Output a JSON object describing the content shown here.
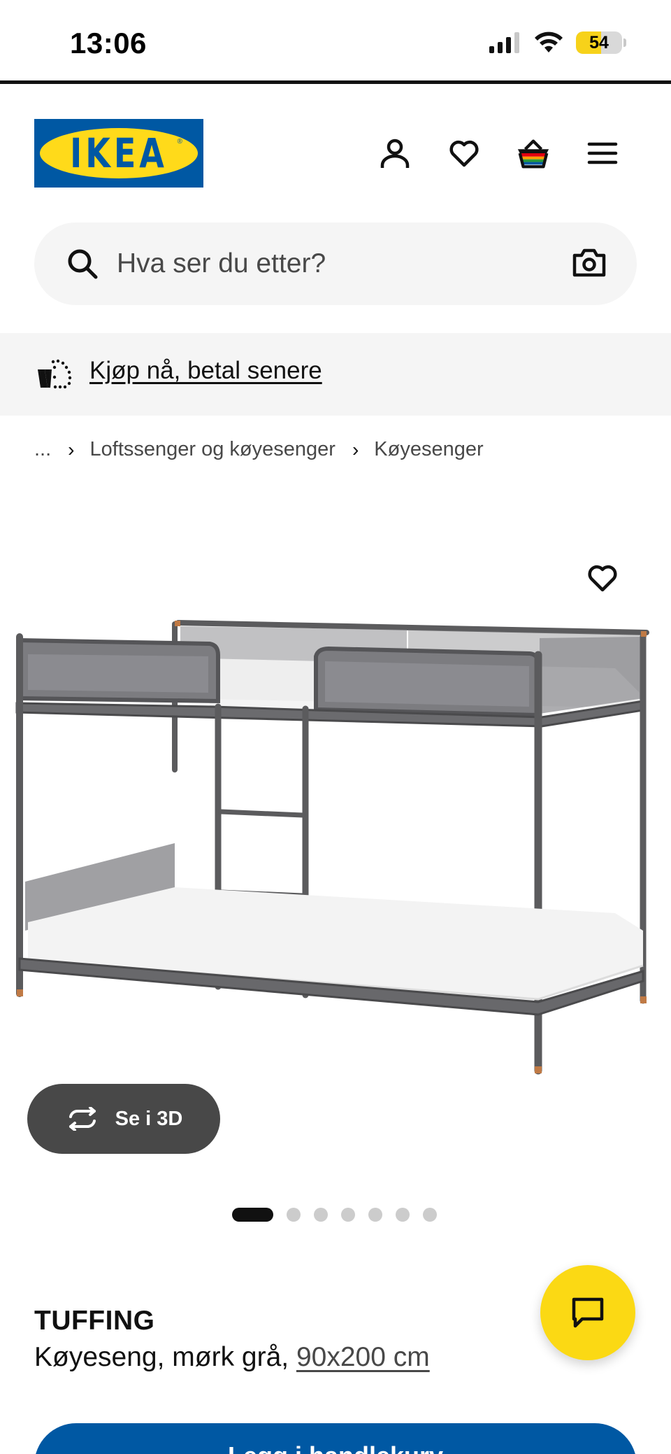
{
  "status_bar": {
    "time": "13:06",
    "battery_level": "54",
    "battery_fraction": 0.54,
    "icons": [
      "cellular-signal-icon",
      "wifi-icon",
      "battery-icon"
    ]
  },
  "header": {
    "logo_text": "IKEA",
    "logo_registered": "®",
    "colors": {
      "brand_blue": "#0058a3",
      "brand_yellow": "#ffda1a"
    },
    "icons": [
      "account-icon",
      "heart-icon",
      "shopping-basket-icon",
      "menu-icon"
    ]
  },
  "search": {
    "placeholder": "Hva ser du etter?",
    "icons": [
      "search-icon",
      "camera-icon"
    ]
  },
  "banner": {
    "link_text": "Kjøp nå, betal senere",
    "icon": "pay-later-bag-icon"
  },
  "breadcrumb": {
    "items": [
      "...",
      "Loftssenger og køyesenger",
      "Køyesenger"
    ]
  },
  "product": {
    "image_icon": "bunk-bed-image",
    "view_3d_label": "Se i 3D",
    "carousel": {
      "count": 7,
      "active_index": 0
    },
    "name": "TUFFING",
    "description": "Køyeseng, mørk grå, ",
    "size": "90x200 cm"
  },
  "chat": {
    "icon": "chat-bubble-icon",
    "color": "#fbd914"
  },
  "cart_button": {
    "label": "Legg i handlekurv",
    "color": "#0058a3"
  }
}
